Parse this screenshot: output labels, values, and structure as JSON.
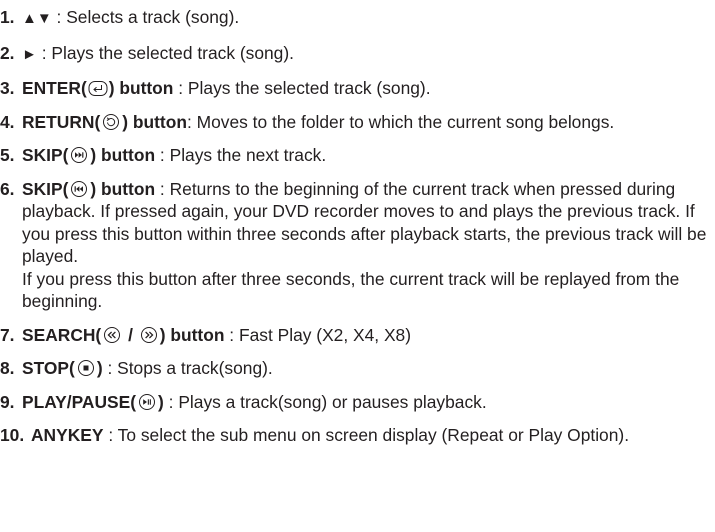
{
  "items": [
    {
      "num": "1.",
      "symbol": "▲▼",
      "text": " : Selects a track (song)."
    },
    {
      "num": "2.",
      "symbol": "►",
      "text": " : Plays the selected track (song)."
    },
    {
      "num": "3.",
      "label_pre": "ENTER(",
      "label_post": ") button",
      "text": " : Plays the selected track (song)."
    },
    {
      "num": "4.",
      "label_pre": "RETURN(",
      "label_post": ") button",
      "text": ": Moves to the folder to which the current song belongs."
    },
    {
      "num": "5.",
      "label_pre": "SKIP(",
      "label_post": ") button",
      "text": " : Plays the next track."
    },
    {
      "num": "6.",
      "label_pre": "SKIP(",
      "label_post": ") button",
      "text": " : Returns to the beginning of the current track when pressed during playback. If pressed again, your DVD recorder moves to and plays the previous track. If you press this button within three seconds after playback starts, the previous track will be played.",
      "text2": "If you press this button after three seconds, the current track will be replayed from the beginning."
    },
    {
      "num": "7.",
      "label_pre": "SEARCH(",
      "label_mid": "/",
      "label_post": ") button",
      "text": " : Fast Play (X2, X4, X8)"
    },
    {
      "num": "8.",
      "label_pre": "STOP(",
      "label_post": ")",
      "text": " : Stops a track(song)."
    },
    {
      "num": "9.",
      "label_pre": "PLAY/PAUSE(",
      "label_post": ")",
      "text": " : Plays a track(song) or pauses playback."
    },
    {
      "num": "10.",
      "label_pre": "ANYKEY",
      "text": " : To select the sub menu on screen display (Repeat or Play Option)."
    }
  ],
  "icons": {
    "enter": "enter-icon",
    "return": "return-icon",
    "skip_next": "skip-next-icon",
    "skip_prev": "skip-previous-icon",
    "search_back": "search-backward-icon",
    "search_fwd": "search-forward-icon",
    "stop": "stop-icon",
    "play_pause": "play-pause-icon"
  }
}
